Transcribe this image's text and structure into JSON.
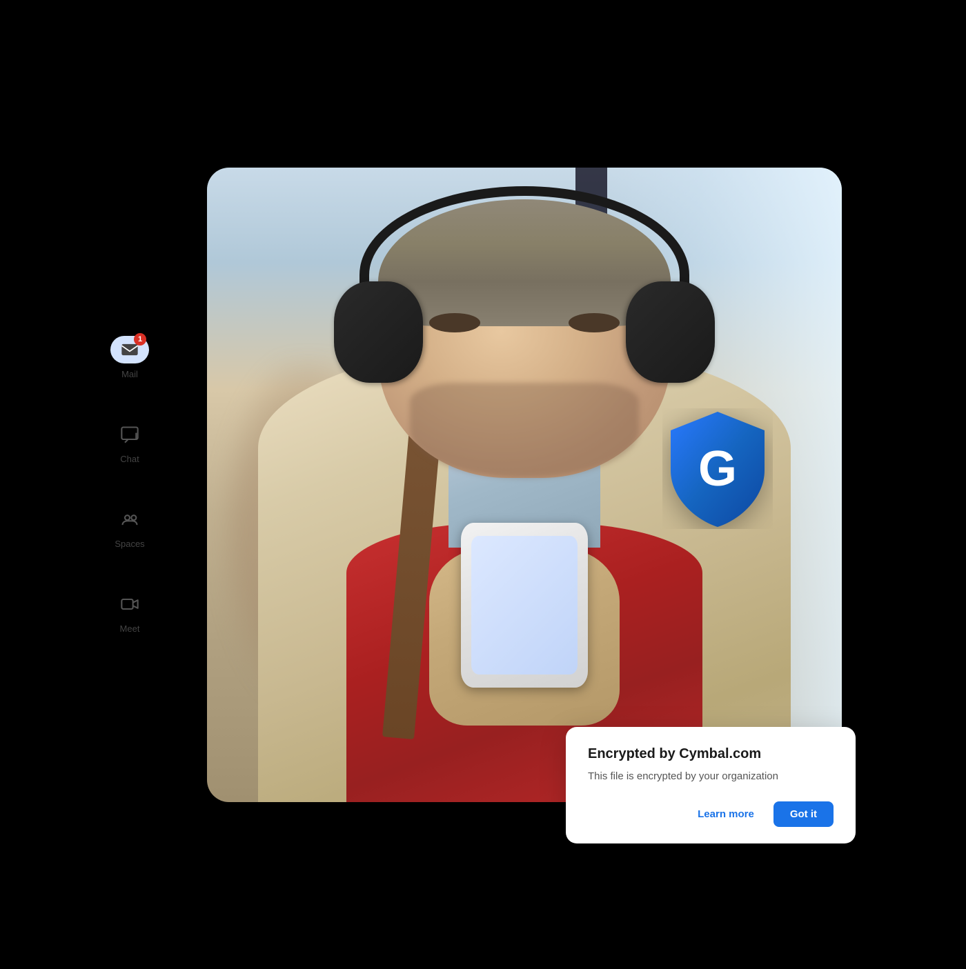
{
  "sidebar": {
    "items": [
      {
        "id": "mail",
        "label": "Mail",
        "icon": "mail-icon",
        "active": true,
        "badge": 1
      },
      {
        "id": "chat",
        "label": "Chat",
        "icon": "chat-icon",
        "active": false,
        "badge": null
      },
      {
        "id": "spaces",
        "label": "Spaces",
        "icon": "spaces-icon",
        "active": false,
        "badge": null
      },
      {
        "id": "meet",
        "label": "Meet",
        "icon": "meet-icon",
        "active": false,
        "badge": null
      }
    ]
  },
  "card": {
    "title": "Encrypted by Cymbal.com",
    "description": "This file is encrypted by your organization",
    "learn_more_label": "Learn more",
    "got_it_label": "Got it"
  },
  "shield": {
    "letter": "G"
  }
}
